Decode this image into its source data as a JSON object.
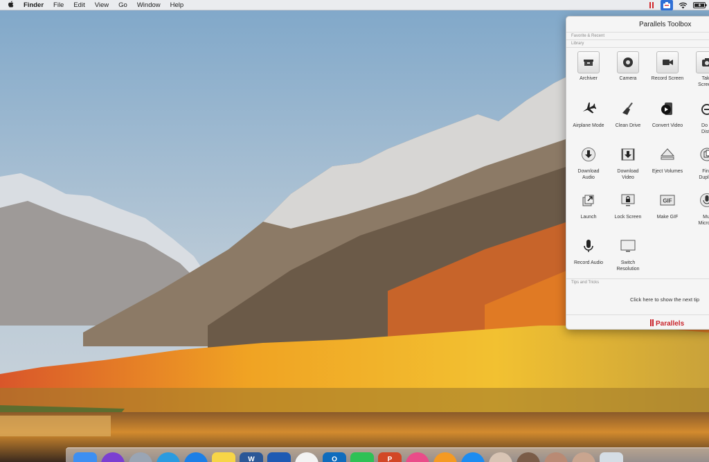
{
  "menubar": {
    "apple_icon": "apple-icon",
    "app_name": "Finder",
    "menus": [
      "File",
      "Edit",
      "View",
      "Go",
      "Window",
      "Help"
    ],
    "status_icons": [
      "parallels-icon",
      "toolbox-icon",
      "wifi-icon",
      "battery-icon"
    ]
  },
  "toolbox": {
    "title": "Parallels Toolbox",
    "sections": {
      "favorites": "Favorite & Recent",
      "library": "Library",
      "tips": "Tips and Tricks"
    },
    "tools": [
      {
        "label": "Archiver",
        "icon": "archiver-icon"
      },
      {
        "label": "Camera",
        "icon": "camera-icon"
      },
      {
        "label": "Record Screen",
        "icon": "record-screen-icon"
      },
      {
        "label": "Take\nScreens",
        "icon": "take-screenshot-icon"
      },
      {
        "label": "Airplane Mode",
        "icon": "airplane-icon"
      },
      {
        "label": "Clean Drive",
        "icon": "broom-icon"
      },
      {
        "label": "Convert Video",
        "icon": "convert-video-icon"
      },
      {
        "label": "Do N\nDistu",
        "icon": "do-not-disturb-icon"
      },
      {
        "label": "Download\nAudio",
        "icon": "download-audio-icon"
      },
      {
        "label": "Download\nVideo",
        "icon": "download-video-icon"
      },
      {
        "label": "Eject Volumes",
        "icon": "eject-icon"
      },
      {
        "label": "Find\nDuplica",
        "icon": "find-duplicates-icon"
      },
      {
        "label": "Launch",
        "icon": "launch-icon"
      },
      {
        "label": "Lock Screen",
        "icon": "lock-screen-icon"
      },
      {
        "label": "Make GIF",
        "icon": "gif-icon"
      },
      {
        "label": "Mut\nMicroph",
        "icon": "mute-microphone-icon"
      },
      {
        "label": "Record Audio",
        "icon": "microphone-icon"
      },
      {
        "label": "Switch\nResolution",
        "icon": "monitor-icon"
      }
    ],
    "tip_text": "Click here to show the next tip",
    "brand": "Parallels"
  },
  "dock": {
    "apps": [
      {
        "name": "finder-icon",
        "color": "#3d8ff2",
        "text": ""
      },
      {
        "name": "siri-icon",
        "color": "#7b3fd1",
        "text": ""
      },
      {
        "name": "launchpad-icon",
        "color": "#9aa5b4",
        "text": ""
      },
      {
        "name": "internet-explorer-icon",
        "color": "#2b9be0",
        "text": ""
      },
      {
        "name": "safari-icon",
        "color": "#1c7fe6",
        "text": ""
      },
      {
        "name": "notes-icon",
        "color": "#f7d547",
        "text": ""
      },
      {
        "name": "word-icon",
        "color": "#2b5797",
        "text": "W"
      },
      {
        "name": "windows-app-icon",
        "color": "#1e5ab3",
        "text": ""
      },
      {
        "name": "photos-icon",
        "color": "#f3f3f3",
        "text": ""
      },
      {
        "name": "outlook-icon",
        "color": "#0f6cbd",
        "text": "O"
      },
      {
        "name": "facetime-icon",
        "color": "#2ec155",
        "text": ""
      },
      {
        "name": "powerpoint-icon",
        "color": "#d24726",
        "text": "P"
      },
      {
        "name": "itunes-icon",
        "color": "#ea4c89",
        "text": ""
      },
      {
        "name": "ibooks-icon",
        "color": "#f59a23",
        "text": ""
      },
      {
        "name": "app-store-icon",
        "color": "#1d8cf0",
        "text": ""
      },
      {
        "name": "contact-avatar-icon",
        "color": "#d8c4b4",
        "text": ""
      },
      {
        "name": "contact-avatar-icon",
        "color": "#7a5c48",
        "text": ""
      },
      {
        "name": "contact-avatar-icon",
        "color": "#b98a74",
        "text": ""
      },
      {
        "name": "contact-avatar-icon",
        "color": "#c9a58f",
        "text": ""
      },
      {
        "name": "trash-icon",
        "color": "#d5dde5",
        "text": ""
      }
    ]
  }
}
